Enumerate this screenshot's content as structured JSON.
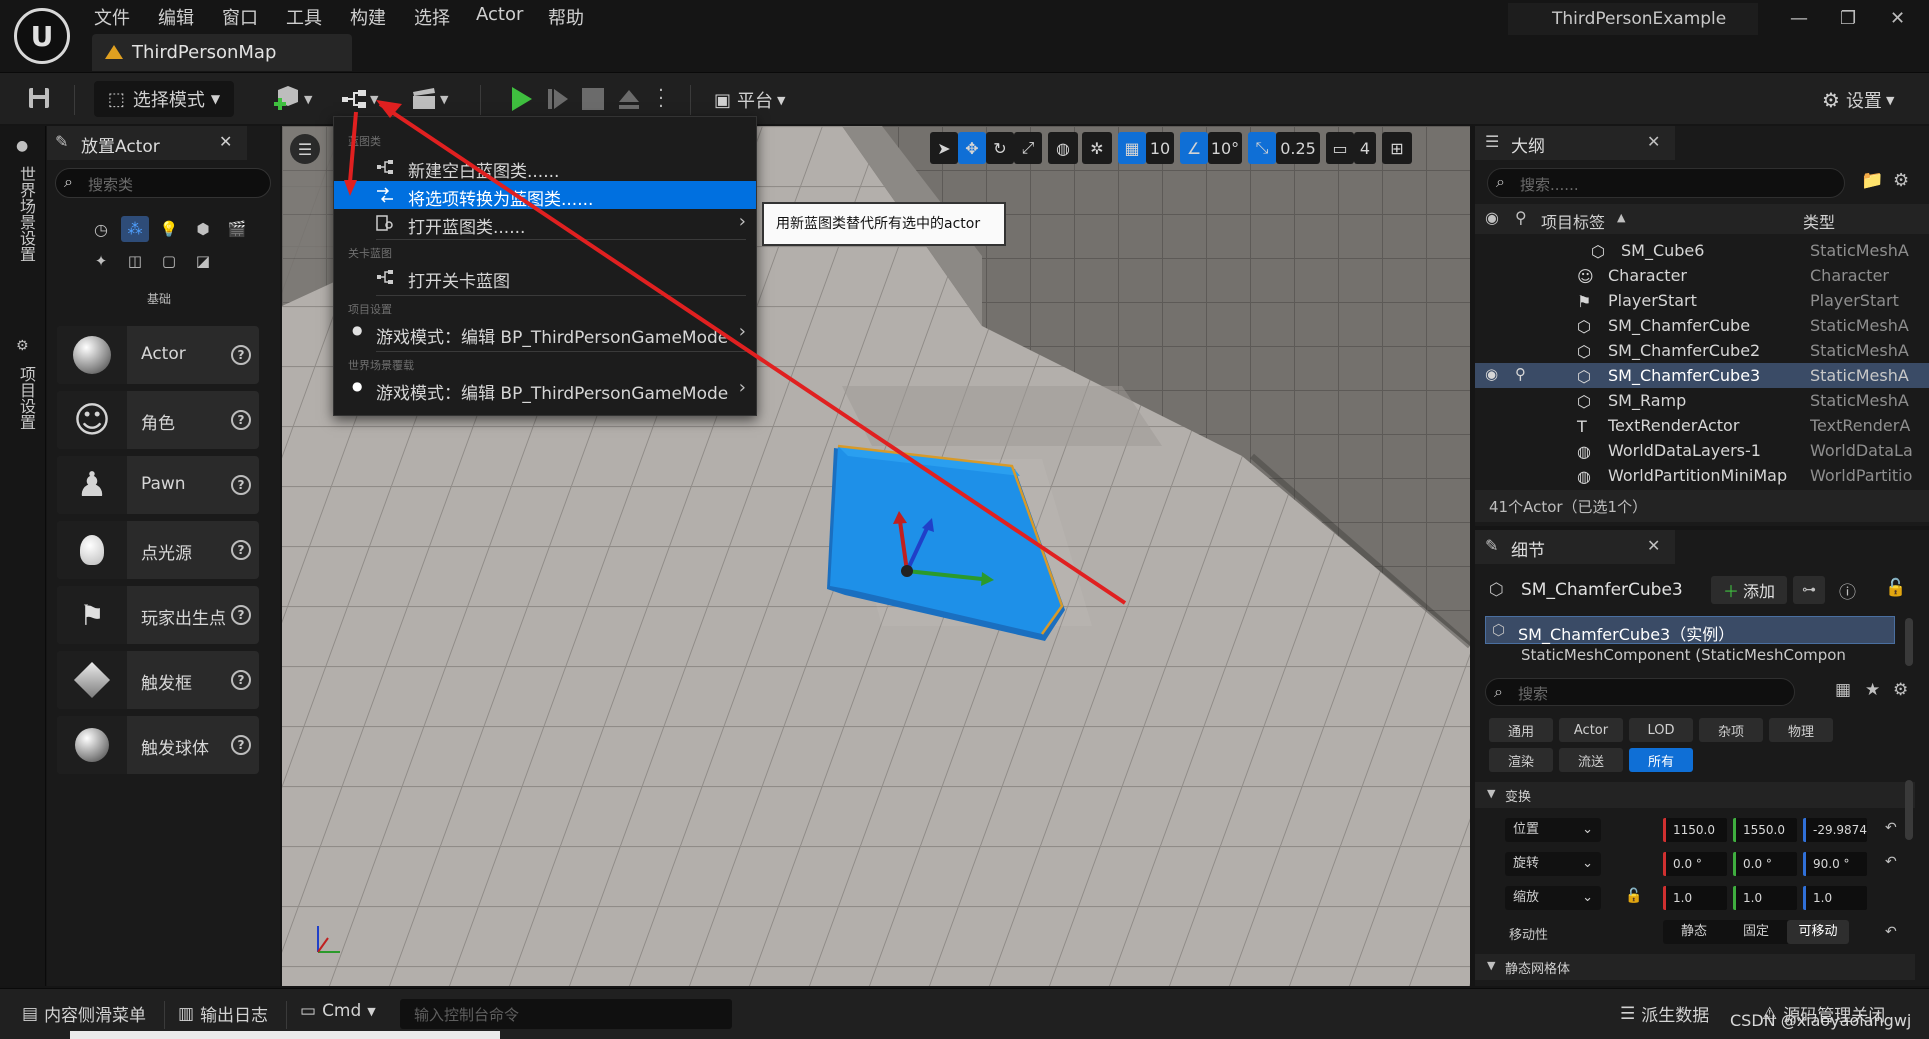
{
  "menu": {
    "items": [
      "文件",
      "编辑",
      "窗口",
      "工具",
      "构建",
      "选择",
      "Actor",
      "帮助"
    ]
  },
  "window": {
    "project_name": "ThirdPersonExample",
    "minimize": "—",
    "restore": "❐",
    "close": "✕"
  },
  "tab": {
    "map_name": "ThirdPersonMap"
  },
  "toolbar": {
    "select_mode": "选择模式",
    "platform": "平台",
    "settings": "设置"
  },
  "left_rail": {
    "world_settings": "世界场景设置",
    "project_settings": "项目设置"
  },
  "place_actor": {
    "title": "放置Actor",
    "search_placeholder": "搜索类",
    "category_label": "基础",
    "items": [
      {
        "label": "Actor",
        "icon": "sphere-icon"
      },
      {
        "label": "角色",
        "icon": "character-icon"
      },
      {
        "label": "Pawn",
        "icon": "pawn-icon"
      },
      {
        "label": "点光源",
        "icon": "bulb-icon"
      },
      {
        "label": "玩家出生点",
        "icon": "flag-icon"
      },
      {
        "label": "触发框",
        "icon": "box-icon"
      },
      {
        "label": "触发球体",
        "icon": "sphere-icon"
      }
    ]
  },
  "viewport": {
    "grid_snap": "10",
    "rotation_snap": "10°",
    "scale_snap": "0.25",
    "camera_speed": "4"
  },
  "dropdown": {
    "section_blueprint": "蓝图类",
    "new_empty_bp": "新建空白蓝图类......",
    "convert_selection": "将选项转换为蓝图类......",
    "open_bp": "打开蓝图类......",
    "section_level": "关卡蓝图",
    "open_level_bp": "打开关卡蓝图",
    "section_project": "项目设置",
    "project_game_mode": "游戏模式：编辑 BP_ThirdPersonGameMode",
    "section_world": "世界场景覆载",
    "world_game_mode": "游戏模式：编辑 BP_ThirdPersonGameMode",
    "tooltip": "用新蓝图类替代所有选中的actor"
  },
  "outliner": {
    "title": "大纲",
    "search_placeholder": "搜索......",
    "col_label": "项目标签",
    "col_type": "类型",
    "rows": [
      {
        "name": "SM_Cube6",
        "type": "StaticMeshA",
        "indent": 1
      },
      {
        "name": "Character",
        "type": "Character",
        "indent": 0
      },
      {
        "name": "PlayerStart",
        "type": "PlayerStart",
        "indent": 0
      },
      {
        "name": "SM_ChamferCube",
        "type": "StaticMeshA",
        "indent": 0
      },
      {
        "name": "SM_ChamferCube2",
        "type": "StaticMeshA",
        "indent": 0
      },
      {
        "name": "SM_ChamferCube3",
        "type": "StaticMeshA",
        "indent": 0,
        "selected": true
      },
      {
        "name": "SM_Ramp",
        "type": "StaticMeshA",
        "indent": 0
      },
      {
        "name": "TextRenderActor",
        "type": "TextRenderA",
        "indent": 0
      },
      {
        "name": "WorldDataLayers-1",
        "type": "WorldDataLa",
        "indent": 0
      },
      {
        "name": "WorldPartitionMiniMap",
        "type": "WorldPartitio",
        "indent": 0
      }
    ],
    "footer": "41个Actor（已选1个）"
  },
  "details": {
    "title": "细节",
    "object_name": "SM_ChamferCube3",
    "add_label": "添加",
    "instance_row": "SM_ChamferCube3（实例）",
    "component_row": "StaticMeshComponent (StaticMeshCompon",
    "search_placeholder": "搜索",
    "categories_row1": [
      "通用",
      "Actor",
      "LOD",
      "杂项",
      "物理"
    ],
    "categories_row2": [
      "渲染",
      "流送",
      "所有"
    ],
    "transform_section": "变换",
    "location_label": "位置",
    "rotation_label": "旋转",
    "scale_label": "缩放",
    "location": [
      "1150.0",
      "1550.0",
      "-29.9874"
    ],
    "rotation": [
      "0.0 °",
      "0.0 °",
      "90.0 °"
    ],
    "scale": [
      "1.0",
      "1.0",
      "1.0"
    ],
    "mobility_label": "移动性",
    "mobility_options": [
      "静态",
      "固定",
      "可移动"
    ],
    "static_mesh_section": "静态网格体"
  },
  "bottombar": {
    "content_drawer": "内容侧滑菜单",
    "output_log": "输出日志",
    "cmd": "Cmd",
    "console_placeholder": "输入控制台命令",
    "derived_data": "派生数据",
    "source_control": "源码管理关闭",
    "watermark": "CSDN @xiaoyaoiangwj"
  },
  "colors": {
    "accent": "#0f6fd6",
    "selection": "#0070e0",
    "annotation_arrow": "#e02020",
    "cube": "#1e90e8"
  }
}
